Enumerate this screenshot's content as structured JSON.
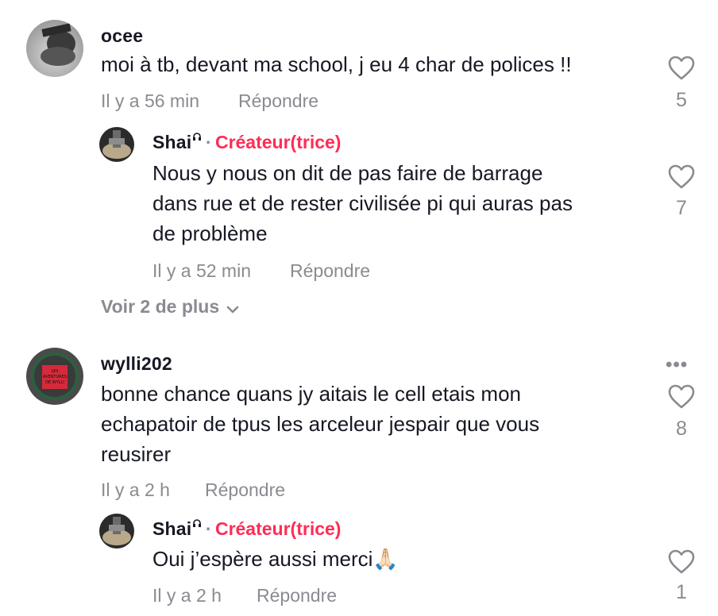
{
  "comments": [
    {
      "username": "ocee",
      "text": "moi à tb, devant ma school, j eu 4 char de polices !!",
      "time": "Il y a 56 min",
      "reply_label": "Répondre",
      "likes": "5",
      "avatar_icon": "gray-photo-avatar"
    },
    {
      "username": "wylli202",
      "text_lines": [
        "bonne chance quans jy aitais le cell etais mon",
        "echapatoir de tpus les arceleur jespair que vous",
        "reusirer"
      ],
      "time": "Il y a 2 h",
      "reply_label": "Répondre",
      "likes": "8",
      "avatar_icon": "red-book-avatar",
      "avatar_text_lines": [
        "LES",
        "AVENTURES",
        "DE WYLLI"
      ]
    }
  ],
  "replies": [
    {
      "username": "Shai",
      "creator_separator": "·",
      "creator_label": "Créateur(trice)",
      "text_lines": [
        "Nous y nous on dit de pas faire de barrage",
        "dans rue et de rester civilisée pi qui auras pas",
        "de problème"
      ],
      "time": "Il y a 52 min",
      "reply_label": "Répondre",
      "likes": "7"
    },
    {
      "username": "Shai",
      "creator_separator": "·",
      "creator_label": "Créateur(trice)",
      "text": "Oui j’espère aussi merci🙏🏻",
      "time": "Il y a 2 h",
      "reply_label": "Répondre",
      "likes": "1"
    }
  ],
  "view_more": {
    "label": "Voir 2 de plus",
    "icon": "chevron-down-icon"
  },
  "more_options": {
    "label": "•••",
    "icon": "more-options-icon"
  },
  "colors": {
    "creator": "#fe2c55",
    "meta": "#8a8b91",
    "text": "#161823"
  }
}
